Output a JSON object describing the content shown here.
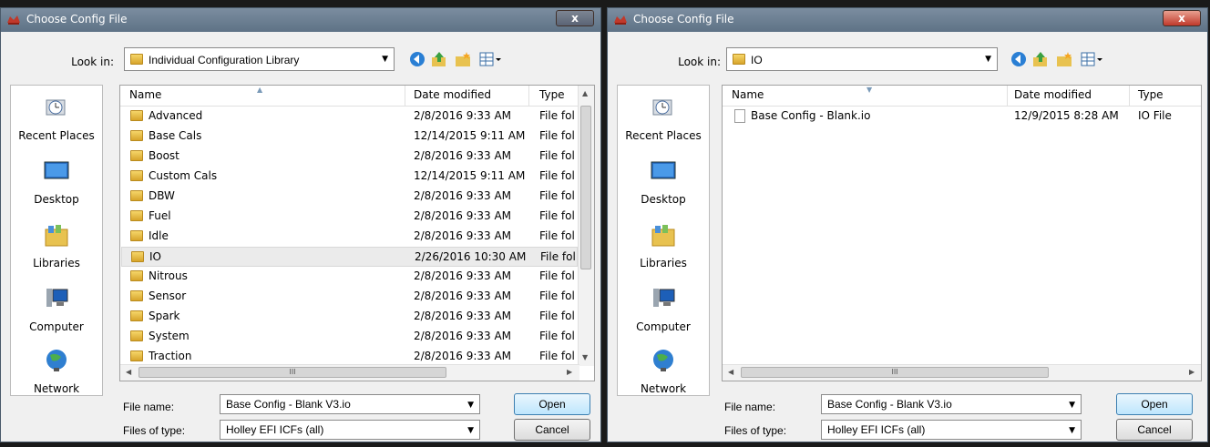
{
  "left_dialog": {
    "title": "Choose Config File",
    "close_label": "x",
    "look_in_label": "Look in:",
    "look_in_value": "Individual Configuration Library",
    "places": [
      "Recent Places",
      "Desktop",
      "Libraries",
      "Computer",
      "Network"
    ],
    "columns": [
      "Name",
      "Date modified",
      "Type"
    ],
    "rows": [
      {
        "name": "Advanced",
        "date": "2/8/2016 9:33 AM",
        "type": "File fol"
      },
      {
        "name": "Base Cals",
        "date": "12/14/2015 9:11 AM",
        "type": "File fol"
      },
      {
        "name": "Boost",
        "date": "2/8/2016 9:33 AM",
        "type": "File fol"
      },
      {
        "name": "Custom Cals",
        "date": "12/14/2015 9:11 AM",
        "type": "File fol"
      },
      {
        "name": "DBW",
        "date": "2/8/2016 9:33 AM",
        "type": "File fol"
      },
      {
        "name": "Fuel",
        "date": "2/8/2016 9:33 AM",
        "type": "File fol"
      },
      {
        "name": "Idle",
        "date": "2/8/2016 9:33 AM",
        "type": "File fol"
      },
      {
        "name": "IO",
        "date": "2/26/2016 10:30 AM",
        "type": "File fol"
      },
      {
        "name": "Nitrous",
        "date": "2/8/2016 9:33 AM",
        "type": "File fol"
      },
      {
        "name": "Sensor",
        "date": "2/8/2016 9:33 AM",
        "type": "File fol"
      },
      {
        "name": "Spark",
        "date": "2/8/2016 9:33 AM",
        "type": "File fol"
      },
      {
        "name": "System",
        "date": "2/8/2016 9:33 AM",
        "type": "File fol"
      },
      {
        "name": "Traction",
        "date": "2/8/2016 9:33 AM",
        "type": "File fol"
      }
    ],
    "selected_row": 7,
    "file_name_label": "File name:",
    "file_name_value": "Base Config - Blank V3.io",
    "files_of_type_label": "Files of type:",
    "files_of_type_value": "Holley EFI ICFs (all)",
    "open_label": "Open",
    "cancel_label": "Cancel"
  },
  "right_dialog": {
    "title": "Choose Config File",
    "close_label": "x",
    "look_in_label": "Look in:",
    "look_in_value": "IO",
    "places": [
      "Recent Places",
      "Desktop",
      "Libraries",
      "Computer",
      "Network"
    ],
    "columns": [
      "Name",
      "Date modified",
      "Type"
    ],
    "rows": [
      {
        "name": "Base Config - Blank.io",
        "date": "12/9/2015 8:28 AM",
        "type": "IO File"
      }
    ],
    "file_name_label": "File name:",
    "file_name_value": "Base Config - Blank V3.io",
    "files_of_type_label": "Files of type:",
    "files_of_type_value": "Holley EFI ICFs (all)",
    "open_label": "Open",
    "cancel_label": "Cancel"
  },
  "colors": {
    "titlebar": "#6b7e92",
    "close_left": "#6b7484",
    "close_right": "#c94a3a",
    "folder": "#e8c250",
    "selection": "#ebebeb",
    "default_button": "#bee6fd"
  },
  "icons": [
    "app-icon",
    "back-icon",
    "up-folder-icon",
    "new-folder-icon",
    "view-menu-icon",
    "folder-icon",
    "file-icon",
    "recent-places-icon",
    "desktop-icon",
    "libraries-icon",
    "computer-icon",
    "network-icon"
  ]
}
